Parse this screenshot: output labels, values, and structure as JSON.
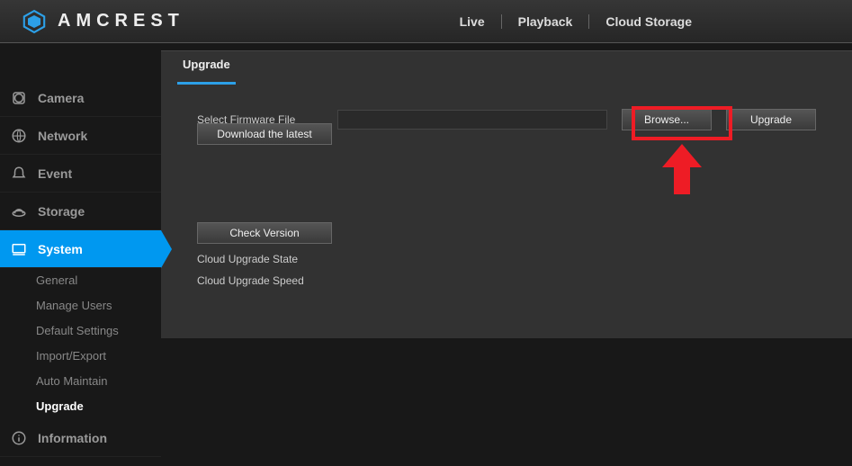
{
  "brand": "AMCREST",
  "topnav": {
    "live": "Live",
    "playback": "Playback",
    "cloud": "Cloud Storage"
  },
  "sidebar": {
    "camera": "Camera",
    "network": "Network",
    "event": "Event",
    "storage": "Storage",
    "system": "System",
    "system_sub": {
      "general": "General",
      "manage_users": "Manage Users",
      "default_settings": "Default Settings",
      "import_export": "Import/Export",
      "auto_maintain": "Auto Maintain",
      "upgrade": "Upgrade"
    },
    "information": "Information"
  },
  "panel": {
    "tab": "Upgrade",
    "select_label": "Select Firmware File",
    "browse": "Browse...",
    "upgrade": "Upgrade",
    "download_latest": "Download the latest",
    "check_version": "Check Version",
    "cloud_state": "Cloud Upgrade State",
    "cloud_speed": "Cloud Upgrade Speed",
    "file_value": ""
  }
}
